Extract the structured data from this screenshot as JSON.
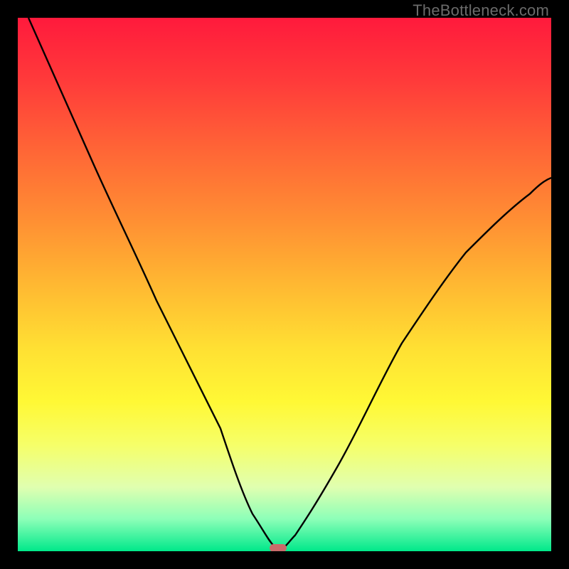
{
  "watermark": "TheBottleneck.com",
  "chart_data": {
    "type": "line",
    "title": "",
    "xlabel": "",
    "ylabel": "",
    "xlim": [
      0,
      100
    ],
    "ylim": [
      0,
      100
    ],
    "grid": false,
    "legend": false,
    "series": [
      {
        "name": "bottleneck-curve",
        "x": [
          2,
          6,
          10,
          14,
          18,
          22,
          26,
          30,
          34,
          38,
          42,
          44,
          46,
          47,
          48,
          49,
          50,
          52,
          56,
          60,
          66,
          72,
          78,
          84,
          90,
          96,
          100
        ],
        "y": [
          100,
          91,
          82,
          73,
          64,
          56,
          47,
          39,
          31,
          23,
          15,
          11,
          7,
          4,
          2,
          1,
          1,
          3,
          9,
          16,
          26,
          36,
          45,
          53,
          60,
          66,
          70
        ]
      }
    ],
    "minimum_marker": {
      "x": 48.5,
      "y": 0.5
    },
    "colors": {
      "gradient_top": "#ff1a3c",
      "gradient_mid": "#ffe033",
      "gradient_bottom": "#00e88a",
      "curve": "#000000",
      "marker": "#c96a6a",
      "frame": "#000000"
    }
  }
}
